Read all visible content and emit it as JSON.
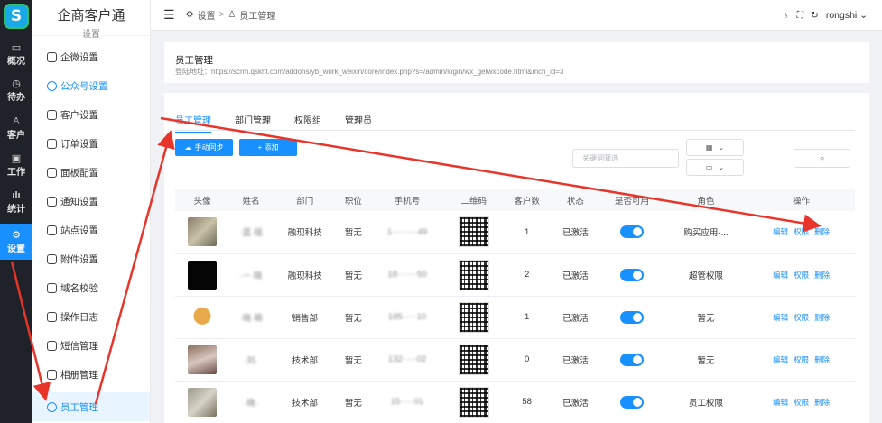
{
  "rail": {
    "logo_letter": "S",
    "items": [
      {
        "label": "概况",
        "icon": "monitor-icon"
      },
      {
        "label": "待办",
        "icon": "clock-icon"
      },
      {
        "label": "客户",
        "icon": "user-icon"
      },
      {
        "label": "工作",
        "icon": "briefcase-icon"
      },
      {
        "label": "统计",
        "icon": "bar-chart-icon"
      },
      {
        "label": "设置",
        "icon": "gear-icon"
      }
    ]
  },
  "sidebar": {
    "brand": "企商客户通",
    "section": "设置",
    "items": [
      {
        "label": "企微设置"
      },
      {
        "label": "公众号设置"
      },
      {
        "label": "客户设置"
      },
      {
        "label": "订单设置"
      },
      {
        "label": "面板配置"
      },
      {
        "label": "通知设置"
      },
      {
        "label": "站点设置"
      },
      {
        "label": "附件设置"
      },
      {
        "label": "域名校验"
      },
      {
        "label": "操作日志"
      },
      {
        "label": "短信管理"
      },
      {
        "label": "相册管理"
      },
      {
        "label": "员工管理"
      }
    ]
  },
  "topbar": {
    "crumb_root": "设置",
    "crumb_sep": ">",
    "crumb_current": "员工管理",
    "user": "rongshi"
  },
  "header_panel": {
    "title": "员工管理",
    "url": "登陆地址：https://scrm.qskht.com/addons/yb_work_weixin/core/index.php?s=/admin/login/wx_getwxcode.html&mch_id=3"
  },
  "tabs": [
    "员工管理",
    "部门管理",
    "权限组",
    "管理员"
  ],
  "toolbar": {
    "sync_label": "手动同步",
    "add_label": "+ 添加",
    "search_placeholder": "关键词筛选"
  },
  "table": {
    "columns": [
      "头像",
      "姓名",
      "部门",
      "职位",
      "手机号",
      "二维码",
      "客户数",
      "状态",
      "是否可用",
      "角色",
      "操作"
    ],
    "ops": [
      "编辑",
      "权限",
      "删除"
    ],
    "rows": [
      {
        "name": "·蓝·瑶",
        "dept": "融现科技",
        "title": "暂无",
        "phone": "1·········49",
        "customers": "1",
        "status": "已激活",
        "role": "购买应用-..."
      },
      {
        "name": "·ㅡ·晓",
        "dept": "融现科技",
        "title": "暂无",
        "phone": "18·······50",
        "customers": "2",
        "status": "已激活",
        "role": "超管权限"
      },
      {
        "name": "·晓·萌",
        "dept": "销售部",
        "title": "暂无",
        "phone": "185·····10",
        "customers": "1",
        "status": "已激活",
        "role": "暂无"
      },
      {
        "name": "·刘·",
        "dept": "技术部",
        "title": "暂无",
        "phone": "132·····02",
        "customers": "0",
        "status": "已激活",
        "role": "暂无"
      },
      {
        "name": "·晓·",
        "dept": "技术部",
        "title": "暂无",
        "phone": "15·····01",
        "customers": "58",
        "status": "已激活",
        "role": "员工权限"
      }
    ]
  },
  "colors": {
    "accent": "#1890ff",
    "annotation": "#e8352b",
    "rail_bg": "#1f2329"
  }
}
